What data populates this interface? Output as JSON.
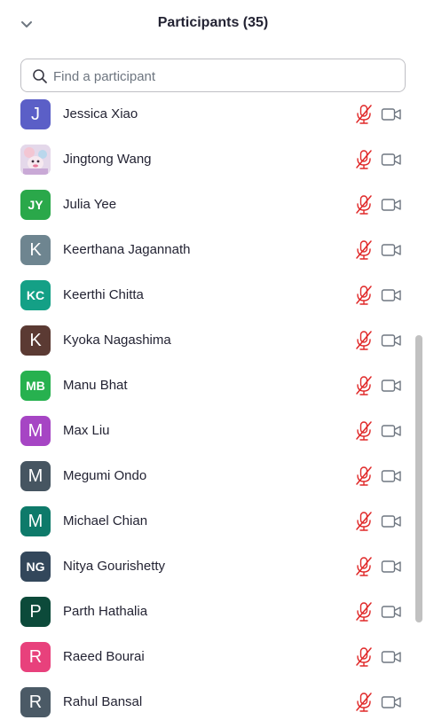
{
  "header": {
    "title": "Participants (35)"
  },
  "search": {
    "placeholder": "Find a participant"
  },
  "colors": {
    "muted_mic": "#e02828",
    "video_off": "#6e7680"
  },
  "participants": [
    {
      "name": "Jessica Xiao",
      "initials": "J",
      "color": "#5b5fc7"
    },
    {
      "name": "Jingtong Wang",
      "initials": "",
      "color": "#d9c6e0",
      "photo": true
    },
    {
      "name": "Julia Yee",
      "initials": "JY",
      "color": "#2aa84a"
    },
    {
      "name": "Keerthana Jagannath",
      "initials": "K",
      "color": "#6e8590"
    },
    {
      "name": "Keerthi Chitta",
      "initials": "KC",
      "color": "#14a086"
    },
    {
      "name": "Kyoka Nagashima",
      "initials": "K",
      "color": "#5b3a33"
    },
    {
      "name": "Manu Bhat",
      "initials": "MB",
      "color": "#27b14f"
    },
    {
      "name": "Max Liu",
      "initials": "M",
      "color": "#a645c4"
    },
    {
      "name": "Megumi Ondo",
      "initials": "M",
      "color": "#465561"
    },
    {
      "name": "Michael Chian",
      "initials": "M",
      "color": "#0e7a6a"
    },
    {
      "name": "Nitya Gourishetty",
      "initials": "NG",
      "color": "#33475b"
    },
    {
      "name": "Parth Hathalia",
      "initials": "P",
      "color": "#0c4a3a"
    },
    {
      "name": "Raeed Bourai",
      "initials": "R",
      "color": "#e8417c"
    },
    {
      "name": "Rahul Bansal",
      "initials": "R",
      "color": "#4b5a66"
    }
  ]
}
